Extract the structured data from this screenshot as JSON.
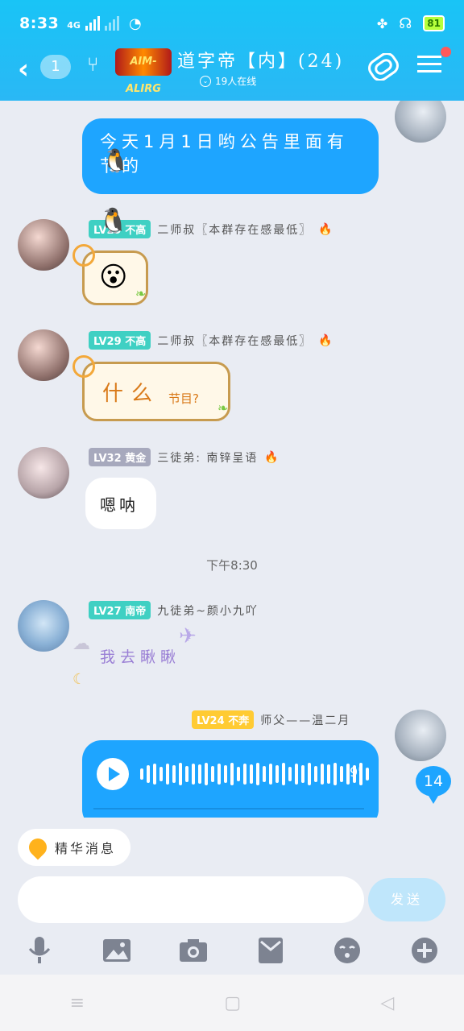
{
  "status": {
    "time": "8:33",
    "network": "4G",
    "battery": "81"
  },
  "header": {
    "back_count": "1",
    "logo_text": "AIM-ALIRG",
    "title": "道字帝【内】(24)",
    "online": "19人在线"
  },
  "messages": [
    {
      "type": "self",
      "text": "今天1月1日哟公告里面有节的"
    },
    {
      "level": "LV29",
      "title": "不高",
      "sender": "二师叔〖本群存在感最低〗",
      "type": "emoji",
      "emoji": "😮"
    },
    {
      "level": "LV29",
      "title": "不高",
      "sender": "二师叔〖本群存在感最低〗",
      "type": "sun",
      "text": "什么",
      "suffix": "节目?"
    },
    {
      "level": "LV32",
      "title": "黄金",
      "sender": "三徒弟: 南锌呈语",
      "type": "white",
      "text": "嗯呐"
    },
    {
      "type": "time",
      "text": "下午8:30"
    },
    {
      "level": "LV27",
      "title": "南帝",
      "sender": "九徒弟~颜小九吖",
      "type": "deco",
      "text": "我去瞅瞅"
    },
    {
      "level": "LV24",
      "title": "不奔",
      "sender": "师父——温二月",
      "type": "voice",
      "duration": "9\"",
      "unread": "14"
    }
  ],
  "bottom": {
    "essence": "精华消息",
    "send": "发送",
    "input_placeholder": ""
  }
}
